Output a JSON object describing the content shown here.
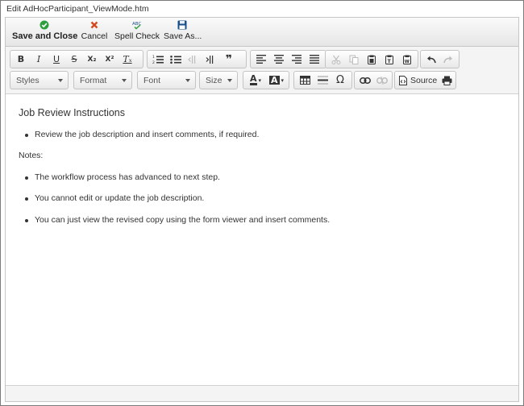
{
  "window": {
    "title": "Edit AdHocParticipant_ViewMode.htm"
  },
  "actions": {
    "save_close": "Save and Close",
    "cancel": "Cancel",
    "spell_check": "Spell Check",
    "save_as": "Save As..."
  },
  "toolbar": {
    "styles": "Styles",
    "format": "Format",
    "font": "Font",
    "size": "Size",
    "source": "Source",
    "bold_glyph": "B",
    "italic_glyph": "I",
    "underline_glyph": "U",
    "strike_glyph": "S",
    "sub_glyph": "X₂",
    "sup_glyph": "X²",
    "clear_glyph": "Tₓ",
    "quote_glyph": "❞",
    "omega_glyph": "Ω",
    "textcolor_glyph": "A",
    "bgcolor_glyph": "A"
  },
  "content": {
    "heading": "Job Review Instructions",
    "bullets_1": [
      "Review the job description and insert comments, if required."
    ],
    "notes_label": "Notes:",
    "bullets_2": [
      "The workflow process has advanced to next step.",
      "You cannot edit or update the job description.",
      "You can just view the revised copy using the form viewer and insert comments."
    ]
  },
  "colors": {
    "save_icon": "#2e9e3e",
    "cancel_icon": "#d4491c",
    "accent": "#1a4f8c"
  }
}
